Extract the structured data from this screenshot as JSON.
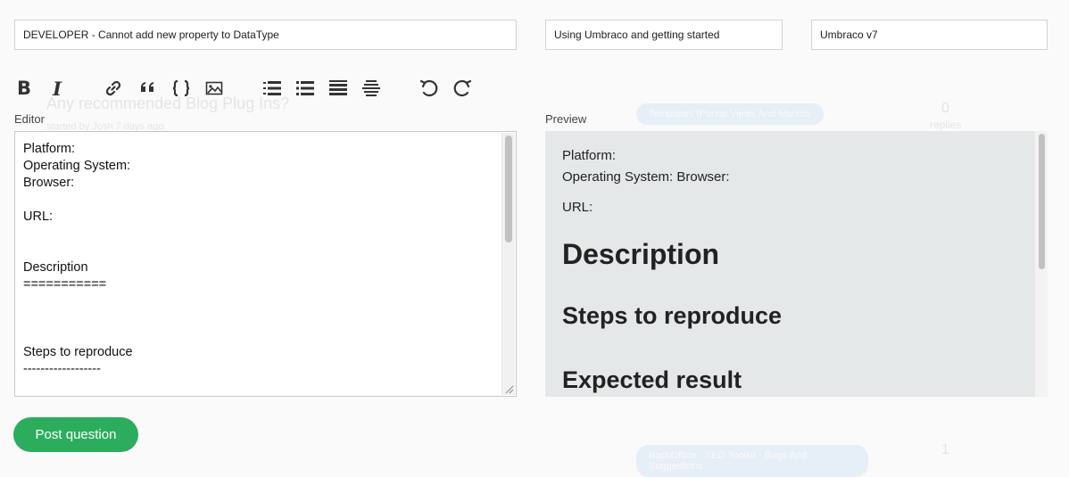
{
  "background_list": {
    "topic_title": "Any recommended Blog Plug Ins?",
    "topic_meta": "started by Josh 7 days ago",
    "tag1": "Templates (Partial Views And Macros",
    "tag2": "BackOffice - SEO Toolkit - Bugs And Suggestions",
    "count1": "0",
    "count1_label": "replies",
    "count2": "1"
  },
  "form": {
    "title_value": "DEVELOPER - Cannot add new property to DataType",
    "category_value": "Using Umbraco and getting started",
    "version_value": "Umbraco v7"
  },
  "toolbar": {
    "buttons": [
      "bold-icon",
      "italic-icon",
      "link-icon",
      "quote-icon",
      "code-icon",
      "image-icon",
      "ordered-list-icon",
      "bullet-list-icon",
      "heading-icon",
      "horizontal-rule-icon",
      "undo-icon",
      "redo-icon"
    ],
    "bold_glyph": "B",
    "italic_glyph": "I"
  },
  "editor": {
    "label": "Editor",
    "content": "Platform:\nOperating System:\nBrowser:\n\nURL:\n\n\nDescription\n===========\n\n\n\nSteps to reproduce\n------------------"
  },
  "preview": {
    "label": "Preview",
    "platform": "Platform:",
    "os_browser": "Operating System: Browser:",
    "url": "URL:",
    "h_description": "Description",
    "h_steps": "Steps to reproduce",
    "h_expected": "Expected result"
  },
  "post_button_label": "Post question",
  "colors": {
    "accent": "#2bad5d",
    "preview_bg": "#e4e8e8"
  }
}
